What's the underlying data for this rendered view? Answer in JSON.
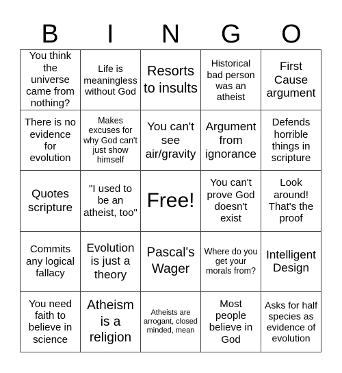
{
  "header": [
    "B",
    "I",
    "N",
    "G",
    "O"
  ],
  "cells": [
    [
      "You think the universe came from nothing?",
      "Life is meaningless without God",
      "Resorts to insults",
      "Historical bad person was an atheist",
      "First Cause argument"
    ],
    [
      "There is no evidence for evolution",
      "Makes excuses for why God can't just show himself",
      "You can't see air/gravity",
      "Argument from ignorance",
      "Defends horrible things in scripture"
    ],
    [
      "Quotes scripture",
      "\"I used to be an atheist, too\"",
      "Free!",
      "You can't prove God doesn't exist",
      "Look around! That's the proof"
    ],
    [
      "Commits any logical fallacy",
      "Evolution is just a theory",
      "Pascal's Wager",
      "Where do you get your morals from?",
      "Intelligent Design"
    ],
    [
      "You need faith to believe in science",
      "Atheism is a religion",
      "Atheists are arrogant, closed minded, mean",
      "Most people believe in God",
      "Asks for half species as evidence of evolution"
    ]
  ]
}
